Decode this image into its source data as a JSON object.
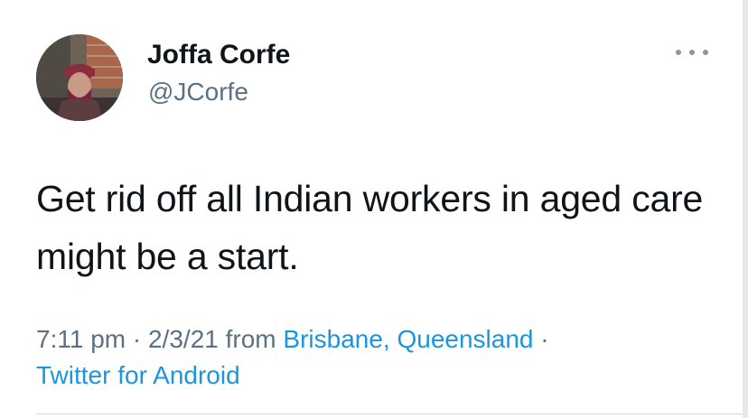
{
  "user": {
    "display_name": "Joffa Corfe",
    "handle": "@JCorfe",
    "avatar_icon": "profile-photo"
  },
  "menu": {
    "icon": "more-horizontal-icon"
  },
  "tweet": {
    "text": "Get rid off all Indian workers in aged care might be a start.",
    "time": "7:11 pm",
    "separator": " · ",
    "date": "2/3/21",
    "from_label": " from ",
    "location": "Brisbane, Queensland",
    "separator2": " · ",
    "source": "Twitter for Android"
  },
  "colors": {
    "text": "#0f1419",
    "secondary": "#5b7083",
    "link": "#1b95e0",
    "divider": "#cfd9de"
  }
}
